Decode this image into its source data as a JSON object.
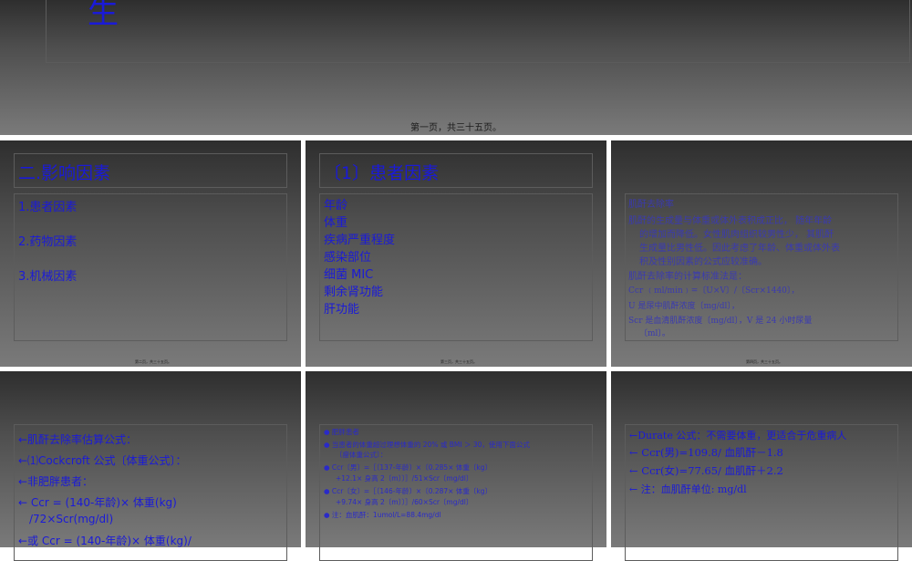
{
  "slide0": {
    "title_fragment": "生",
    "footer": "第一页，共三十五页。"
  },
  "slide1": {
    "title": "二.影响因素",
    "items": [
      "1.患者因素",
      "2.药物因素",
      "3.机械因素"
    ],
    "footer": "第二页，共三十五页。"
  },
  "slide2": {
    "title": "〔1〕患者因素",
    "items": [
      "年龄",
      "体重",
      "疾病严重程度",
      "感染部位",
      "细菌 MIC",
      "剩余肾功能",
      "肝功能"
    ],
    "footer": "第三页，共三十五页。"
  },
  "slide3": {
    "lines": [
      "肌酐去除率",
      "肌酐的生成量与体重或体外表积成正比，  随年年龄",
      "的增加而降低。女性肌肉组织较男性少，  其肌酐",
      "生成量比男性低。因此考虑了年龄、体重或体外表",
      "积及性别因素的公式应较准确。",
      "肌酐去除率的计算标准法是：",
      "Ccr ﹙ml/min﹚=〔U×V〕/〔Scr×1440〕，",
      "U 是尿中肌酐浓度〔mg/dl〕，",
      "Scr 是血清肌酐浓度〔mg/dl〕，V 是 24 小时尿量",
      "〔ml〕。"
    ],
    "footer": "第四页，共三十五页。"
  },
  "slide4": {
    "lines": [
      "←肌酐去除率估算公式：",
      "←⑴Cockcroft 公式〔体重公式〕：",
      "←非肥胖患者：",
      "←   Ccr = (140-年龄)× 体重(kg)",
      "/72×Scr(mg/dl)",
      "←或 Ccr = (140-年龄)× 体重(kg)/"
    ]
  },
  "slide5": {
    "lines": [
      "●  肥胖患者",
      "●  当患者的体重超过理想体重的 20% 或 BMI ＞ 30，使用下面公式",
      "〔瘦体重公式〕：",
      "●  Ccr〔男〕=［〔137-年龄〕×〔0.285× 体重〔kg〕",
      "+12.1× 身高 2〔m〕〕］/51×Scr〔mg/dl〕",
      "●  Ccr〔女〕=［〔146-年龄〕×〔0.287× 体重〔kg〕",
      "+9.74× 身高 2〔m〕〕］/60×Scr〔mg/dl〕",
      "●  注：血肌酐：1umol/L=88.4mg/dl"
    ]
  },
  "slide6": {
    "lines": [
      "←Durate 公式：不需要体重，更适合于危重病人",
      "←    Ccr(男)=109.8/ 血肌酐－1.8",
      "←    Ccr(女)=77.65/ 血肌酐＋2.2",
      "←        注：血肌酐单位: mg/dl"
    ]
  }
}
